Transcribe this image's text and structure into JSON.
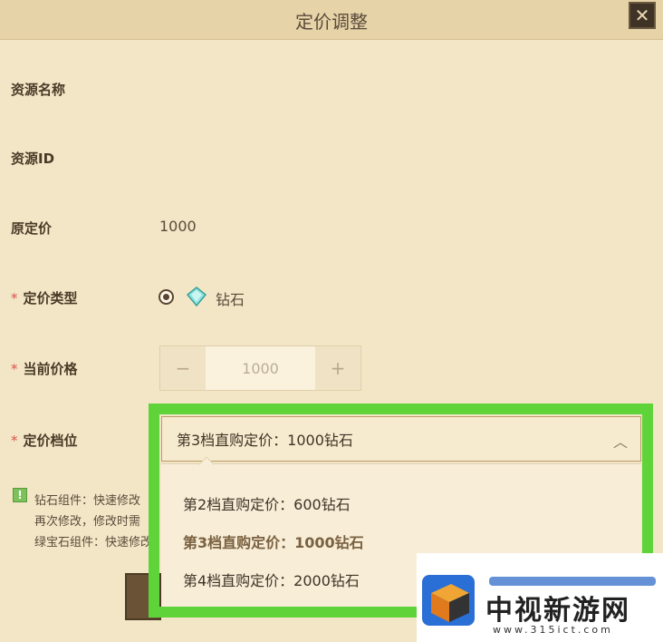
{
  "window": {
    "title": "定价调整"
  },
  "form": {
    "resource_name_label": "资源名称",
    "resource_id_label": "资源ID",
    "original_price_label": "原定价",
    "original_price_value": "1000",
    "required_mark": "*",
    "pricing_type_label": "定价类型",
    "pricing_type_option": "钻石",
    "current_price_label": "当前价格",
    "current_price_value": "1000",
    "decrement": "−",
    "increment": "+",
    "tier_label": "定价档位"
  },
  "dropdown": {
    "selected": "第3档直购定价：1000钻石",
    "options": [
      "第2档直购定价：600钻石",
      "第3档直购定价：1000钻石",
      "第4档直购定价：2000钻石"
    ]
  },
  "hint": {
    "lines": [
      "钻石组件：快速修改",
      "再次修改，修改时需",
      "绿宝石组件：快速修改"
    ]
  },
  "watermark": {
    "text": "中视新游网",
    "url": "www.315ict.com"
  },
  "colors": {
    "highlight": "#5fd43a",
    "background": "#f3e6c6",
    "titlebar": "#e6d3a8"
  }
}
